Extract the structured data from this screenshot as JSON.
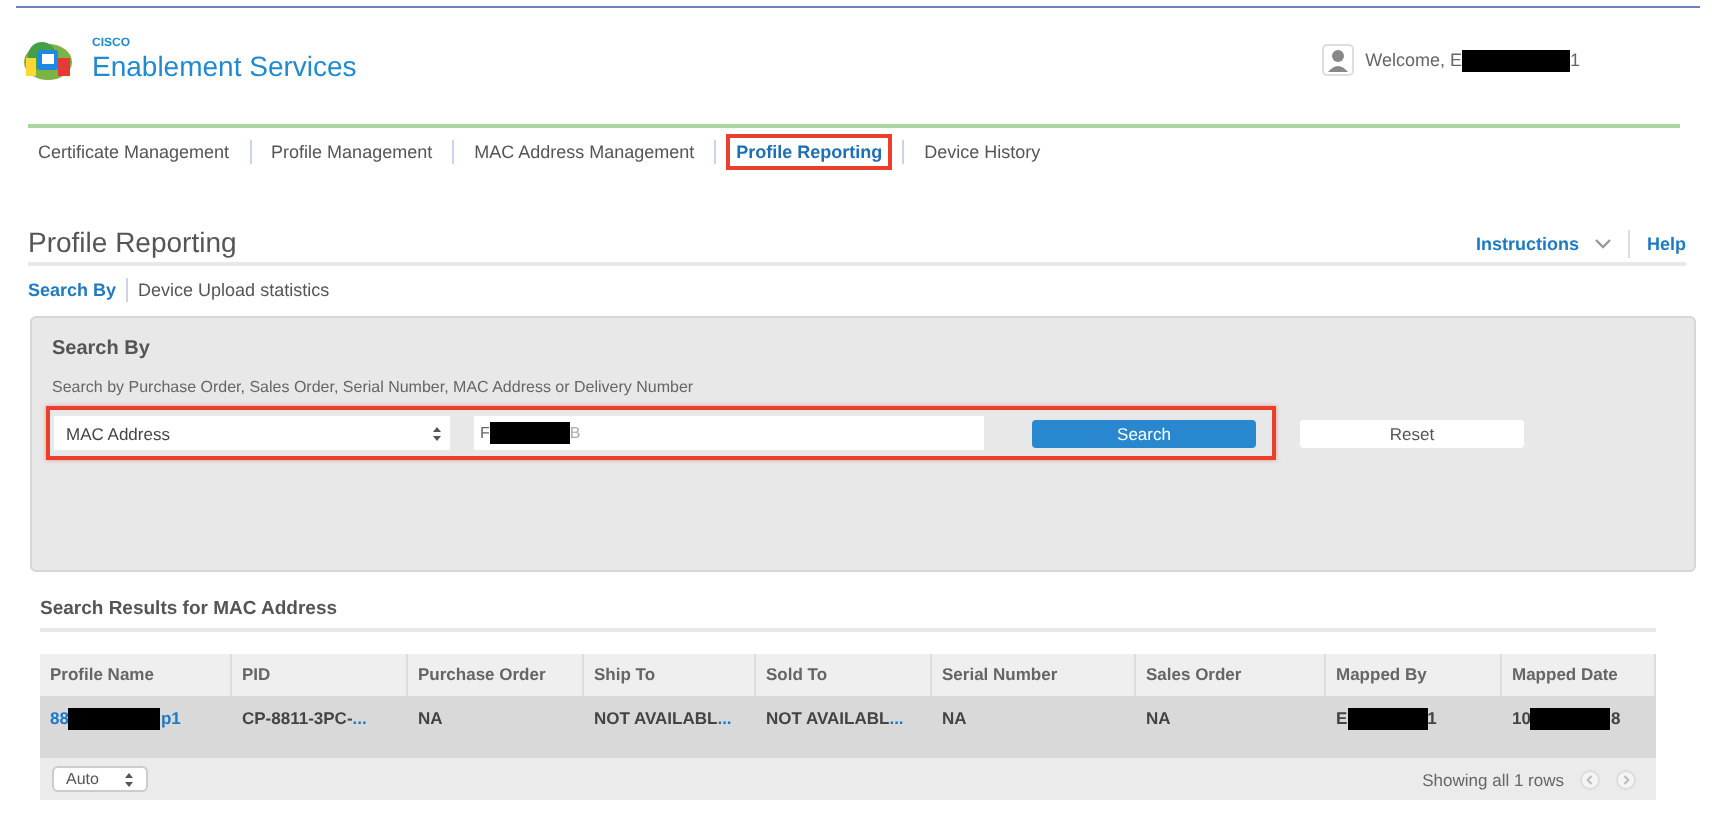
{
  "header": {
    "brand_small": "CISCO",
    "brand": "Enablement Services",
    "welcome": {
      "start": "Welcome, E",
      "end": "1",
      "redacted": true
    }
  },
  "nav_tabs": [
    {
      "label": "Certificate Management",
      "selected": false,
      "highlighted": false
    },
    {
      "label": "Profile Management",
      "selected": false,
      "highlighted": false
    },
    {
      "label": "MAC Address Management",
      "selected": false,
      "highlighted": false
    },
    {
      "label": "Profile Reporting",
      "selected": true,
      "highlighted": true
    },
    {
      "label": "Device History",
      "selected": false,
      "highlighted": false
    }
  ],
  "page": {
    "title": "Profile Reporting",
    "instructions": "Instructions",
    "help": "Help"
  },
  "sub_tabs": [
    {
      "label": "Search By",
      "selected": true
    },
    {
      "label": "Device Upload statistics",
      "selected": false
    }
  ],
  "search_panel": {
    "title": "Search By",
    "hint": "Search by Purchase Order, Sales Order, Serial Number, MAC Address or Delivery Number",
    "highlighted": true,
    "type_select": "MAC Address",
    "value": {
      "start": "F",
      "end": "B",
      "redacted": true
    },
    "search_button": "Search",
    "reset_button": "Reset"
  },
  "results": {
    "title": "Search Results for MAC Address",
    "columns": [
      "Profile Name",
      "PID",
      "Purchase Order",
      "Ship To",
      "Sold To",
      "Serial Number",
      "Sales Order",
      "Mapped By",
      "Mapped Date"
    ],
    "rows": [
      [
        {
          "kind": "redacted",
          "start": "88",
          "end": "p1",
          "link": true
        },
        {
          "kind": "truncated",
          "text": "CP-8811-3PC-",
          "more": "..."
        },
        {
          "kind": "plain",
          "text": "NA"
        },
        {
          "kind": "truncated",
          "text": "NOT AVAILABL",
          "more": "..."
        },
        {
          "kind": "truncated",
          "text": "NOT AVAILABL",
          "more": "..."
        },
        {
          "kind": "plain",
          "text": "NA"
        },
        {
          "kind": "plain",
          "text": "NA"
        },
        {
          "kind": "redacted",
          "start": "E",
          "end": "1",
          "link": false
        },
        {
          "kind": "redacted",
          "start": "10",
          "end": "8",
          "link": false
        }
      ]
    ],
    "page_size": "Auto",
    "summary": "Showing all 1 rows"
  }
}
